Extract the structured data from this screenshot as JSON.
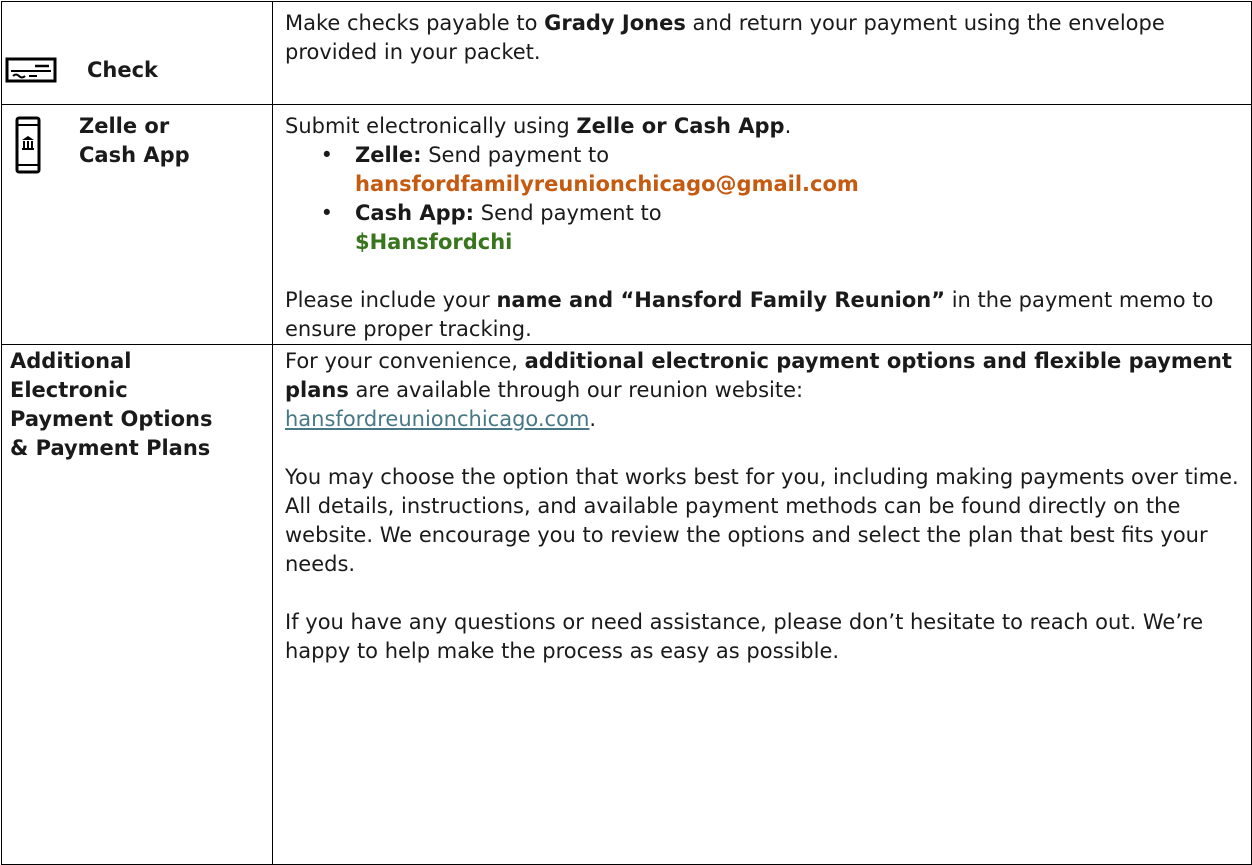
{
  "rows": {
    "check": {
      "icon": "check-icon",
      "label": "Check",
      "text_pre": "Make checks payable to ",
      "payee": "Grady Jones",
      "text_post": " and return your payment using the envelope provided in your packet."
    },
    "zelle": {
      "icon": "phone-bank-icon",
      "label_line1": "Zelle or",
      "label_line2": "Cash App",
      "intro_pre": "Submit electronically using ",
      "intro_bold": "Zelle or Cash App",
      "intro_post": ".",
      "bullets": [
        {
          "label": "Zelle:",
          "text": " Send payment to",
          "value": "hansfordfamilyreunionchicago@gmail.com"
        },
        {
          "label": "Cash App:",
          "text": " Send payment to",
          "value": "$Hansfordchi"
        }
      ],
      "bullet_char": "•",
      "memo_pre": "Please include your ",
      "memo_bold": "name and “Hansford Family Reunion”",
      "memo_post": " in the payment memo to ensure proper tracking."
    },
    "additional": {
      "label_lines": [
        "Additional",
        "Electronic",
        "Payment Options",
        "& Payment Plans"
      ],
      "p1_pre": "For your convenience, ",
      "p1_bold": "additional electronic payment options and flexible payment plans",
      "p1_post": " are available through our reunion website:",
      "link": "hansfordreunionchicago.com",
      "link_after": ".",
      "p2": "You may choose the option that works best for you, including making payments over time.",
      "p3": "All details, instructions, and available payment methods can be found directly on the website. We encourage you to review the options and select the plan that best fits your needs.",
      "p4": "If you have any questions or need assistance, please don’t hesitate to reach out. We’re happy to help make the process as easy as possible."
    }
  }
}
